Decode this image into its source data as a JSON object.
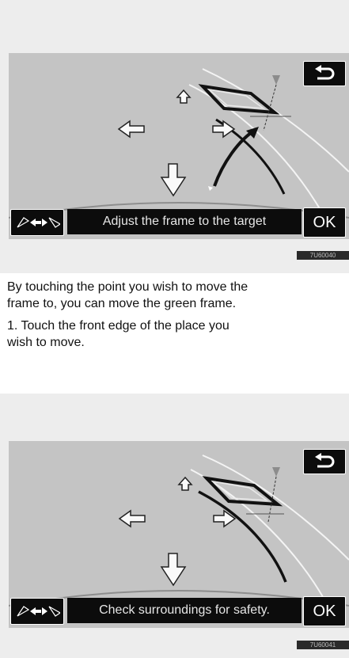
{
  "screens": [
    {
      "message": "Adjust the frame to the target",
      "ok_label": "OK",
      "figure_id": "7U60040",
      "back_icon": "return-arrow-icon",
      "switch_icon": "parking-mode-switch-icon"
    },
    {
      "message": "Check surroundings for safety.",
      "ok_label": "OK",
      "figure_id": "7U60041",
      "back_icon": "return-arrow-icon",
      "switch_icon": "parking-mode-switch-icon"
    }
  ],
  "paragraphs": {
    "intro_line1": "By touching the point you wish to move the",
    "intro_line2": "frame to, you can move the green frame.",
    "step1_line1": "1.  Touch the front edge of the place you",
    "step1_line2": "wish to move."
  }
}
